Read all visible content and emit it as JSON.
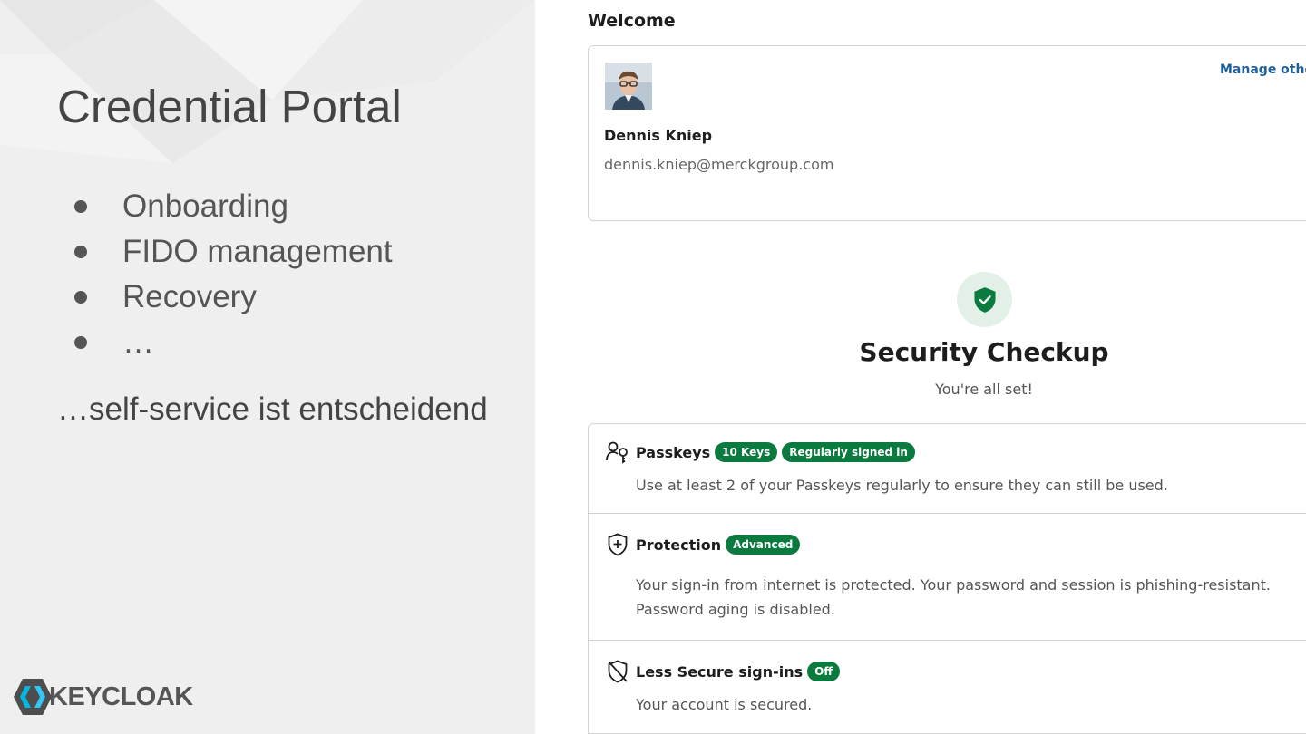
{
  "slide": {
    "title": "Credential Portal",
    "bullets": [
      "Onboarding",
      "FIDO management",
      "Recovery",
      "…"
    ],
    "tagline": "…self-service ist entscheidend",
    "logo_text": "KEYCLOAK"
  },
  "account": {
    "welcome": "Welcome",
    "manage_link": "Manage other",
    "user_name": "Dennis Kniep",
    "user_email": "dennis.kniep@merckgroup.com",
    "checkup_title": "Security Checkup",
    "checkup_subtitle": "You're all set!",
    "checks": [
      {
        "title": "Passkeys",
        "badges": [
          "10 Keys",
          "Regularly signed in"
        ],
        "description": "Use at least 2 of your Passkeys regularly to ensure they can still be used."
      },
      {
        "title": "Protection",
        "badges": [
          "Advanced"
        ],
        "description": "Your sign-in from internet is protected. Your password and session is phishing-resistant. Password aging is disabled."
      },
      {
        "title": "Less Secure sign-ins",
        "badges": [
          "Off"
        ],
        "description": "Your account is secured."
      }
    ]
  },
  "colors": {
    "badge_green": "#0b7a3e",
    "link_blue": "#1f5f9c",
    "shield_green": "#0b7a3e"
  },
  "icons": [
    "shield-check-icon",
    "passkey-icon",
    "shield-plus-icon",
    "shield-off-icon",
    "keycloak-logo"
  ]
}
